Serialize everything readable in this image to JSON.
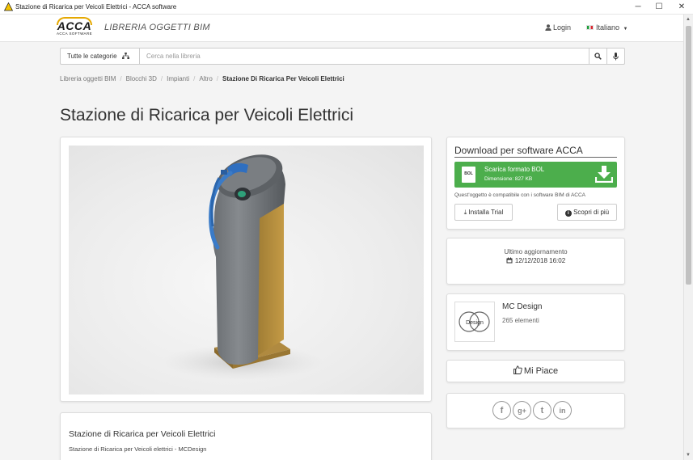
{
  "window": {
    "title": "Stazione di Ricarica per Veicoli Elettrici - ACCA software",
    "minimize": "─",
    "maximize": "☐",
    "close": "✕"
  },
  "header": {
    "logo_text": "ACCA",
    "logo_sub": "ACCA SOFTWARE",
    "brand_title": "LIBRERIA OGGETTI BIM",
    "login_label": "Login",
    "language_label": "Italiano"
  },
  "search": {
    "category_label": "Tutte le categorie",
    "placeholder": "Cerca nella libreria",
    "value": ""
  },
  "breadcrumb": {
    "items": [
      "Libreria oggetti BIM",
      "Blocchi 3D",
      "Impianti",
      "Altro"
    ],
    "separator": "/",
    "current": "Stazione Di Ricarica Per Veicoli Elettrici"
  },
  "page": {
    "title": "Stazione di Ricarica per Veicoli Elettrici"
  },
  "download": {
    "title": "Download per software ACCA",
    "button_label": "Scarica formato BOL",
    "file_size": "Dimensione: 827 KB",
    "bol_badge": "BOL",
    "compat_note": "Quest'oggetto è compatibile con i software BIM di ACCA",
    "install_trial": "Installa Trial",
    "learn_more": "Scopri di più"
  },
  "update": {
    "label": "Ultimo aggiornamento",
    "date": "12/12/2018 16:02"
  },
  "author": {
    "name": "MC Design",
    "count": "265 elementi",
    "logo_text": "Design"
  },
  "like": {
    "label": "Mi Piace"
  },
  "social": {
    "facebook": "f",
    "googleplus": "g+",
    "twitter": "t",
    "linkedin": "in"
  },
  "description": {
    "title": "Stazione di Ricarica per Veicoli Elettrici",
    "subtitle": "Stazione di Ricarica per Veicoli elettrici - MCDesign"
  },
  "colors": {
    "accent_green": "#4cae4c",
    "logo_yellow": "#e5a800",
    "charger_gray": "#6f7377",
    "charger_gold": "#b18b3a",
    "cable_blue": "#3a7bc8"
  }
}
